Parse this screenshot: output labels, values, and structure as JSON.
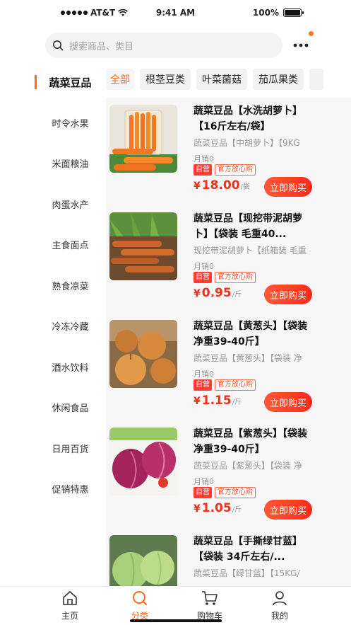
{
  "status_bar": {
    "carrier": "AT&T",
    "time": "9:41 AM",
    "battery": "100%"
  },
  "search": {
    "placeholder": "搜索商品、类目",
    "more_icon": "more-dots-icon"
  },
  "colors": {
    "accent": "#ff6a1a",
    "price": "#ff2a1a",
    "tag_red": "#ff3b2f"
  },
  "sidebar": {
    "items": [
      {
        "label": "蔬菜豆品",
        "active": true
      },
      {
        "label": "时令水果"
      },
      {
        "label": "米面粮油"
      },
      {
        "label": "肉蛋水产"
      },
      {
        "label": "主食面点"
      },
      {
        "label": "熟食凉菜"
      },
      {
        "label": "冷冻冷藏"
      },
      {
        "label": "酒水饮料"
      },
      {
        "label": "休闲食品"
      },
      {
        "label": "日用百货"
      },
      {
        "label": "促销特惠"
      }
    ]
  },
  "subtabs": [
    {
      "label": "全部",
      "active": true
    },
    {
      "label": "根茎豆类"
    },
    {
      "label": "叶菜菌菇"
    },
    {
      "label": "茄瓜果类"
    }
  ],
  "products": [
    {
      "title": "蔬菜豆品【水洗胡萝卜】【16斤左右/袋】",
      "spec": "蔬菜豆品【中胡萝卜】【9KG",
      "sales": "月销0",
      "tag_self": "自营",
      "tag_official": "官方放心购",
      "currency": "¥",
      "price": "18.00",
      "unit": "/袋",
      "buy": "立即购买",
      "image": "carrots-in-glass"
    },
    {
      "title": "蔬菜豆品【现挖带泥胡萝卜】【袋装 毛重40...",
      "spec": "现挖带泥胡萝卜【纸箱装 毛重",
      "sales": "月销0",
      "tag_self": "自营",
      "tag_official": "官方放心购",
      "currency": "¥",
      "price": "0.95",
      "unit": "/斤",
      "buy": "立即购买",
      "image": "muddy-carrots"
    },
    {
      "title": "蔬菜豆品【黄葱头】【袋装 净重39-40斤】",
      "spec": "蔬菜豆品【黄葱头】【袋装 净",
      "sales": "月销0",
      "tag_self": "自营",
      "tag_official": "官方放心购",
      "currency": "¥",
      "price": "1.15",
      "unit": "/斤",
      "buy": "立即购买",
      "image": "yellow-onions"
    },
    {
      "title": "蔬菜豆品【紫葱头】【袋装 净重39-40斤】",
      "spec": "蔬菜豆品【紫葱头】【袋装 净",
      "sales": "月销0",
      "tag_self": "自营",
      "tag_official": "官方放心购",
      "currency": "¥",
      "price": "1.05",
      "unit": "/斤",
      "buy": "立即购买",
      "image": "purple-onions"
    },
    {
      "title": "蔬菜豆品【手撕绿甘蓝】【袋装 34斤左右/...",
      "spec": "蔬菜豆品【绿甘蓝】【15KG/",
      "image": "green-cabbage"
    }
  ],
  "tabbar": {
    "items": [
      {
        "label": "主页",
        "icon": "home-icon"
      },
      {
        "label": "分类",
        "icon": "search-category-icon",
        "active": true
      },
      {
        "label": "购物车",
        "icon": "cart-icon"
      },
      {
        "label": "我的",
        "icon": "user-icon"
      }
    ]
  }
}
